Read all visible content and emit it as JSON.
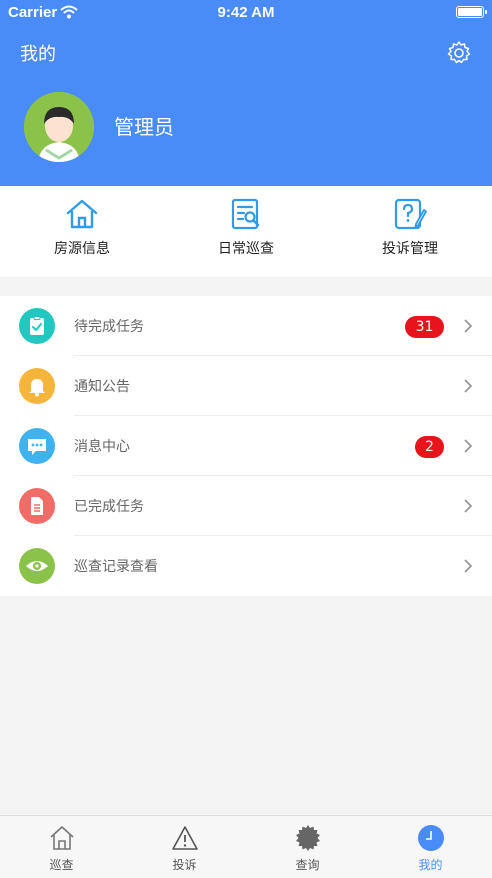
{
  "status_bar": {
    "carrier": "Carrier",
    "time": "9:42 AM"
  },
  "header": {
    "title": "我的",
    "user_name": "管理员"
  },
  "tiles": [
    {
      "label": "房源信息",
      "icon": "house-icon"
    },
    {
      "label": "日常巡查",
      "icon": "inspection-document-icon"
    },
    {
      "label": "投诉管理",
      "icon": "complaint-edit-icon"
    }
  ],
  "menu": [
    {
      "label": "待完成任务",
      "icon": "clipboard-check-icon",
      "color": "#22c7c0",
      "badge": "31"
    },
    {
      "label": "通知公告",
      "icon": "bell-icon",
      "color": "#f5b53a",
      "badge": ""
    },
    {
      "label": "消息中心",
      "icon": "chat-bubble-icon",
      "color": "#3fb3ef",
      "badge": "2"
    },
    {
      "label": "已完成任务",
      "icon": "document-icon",
      "color": "#f06d67",
      "badge": ""
    },
    {
      "label": "巡查记录查看",
      "icon": "eye-icon",
      "color": "#8bc34a",
      "badge": ""
    }
  ],
  "tabbar": [
    {
      "label": "巡查",
      "icon": "home-icon",
      "active": false
    },
    {
      "label": "投诉",
      "icon": "warning-icon",
      "active": false
    },
    {
      "label": "查询",
      "icon": "gear-badge-icon",
      "active": false
    },
    {
      "label": "我的",
      "icon": "clock-icon",
      "active": true
    }
  ],
  "colors": {
    "primary": "#4a8cf7",
    "badge": "#e8141b"
  }
}
